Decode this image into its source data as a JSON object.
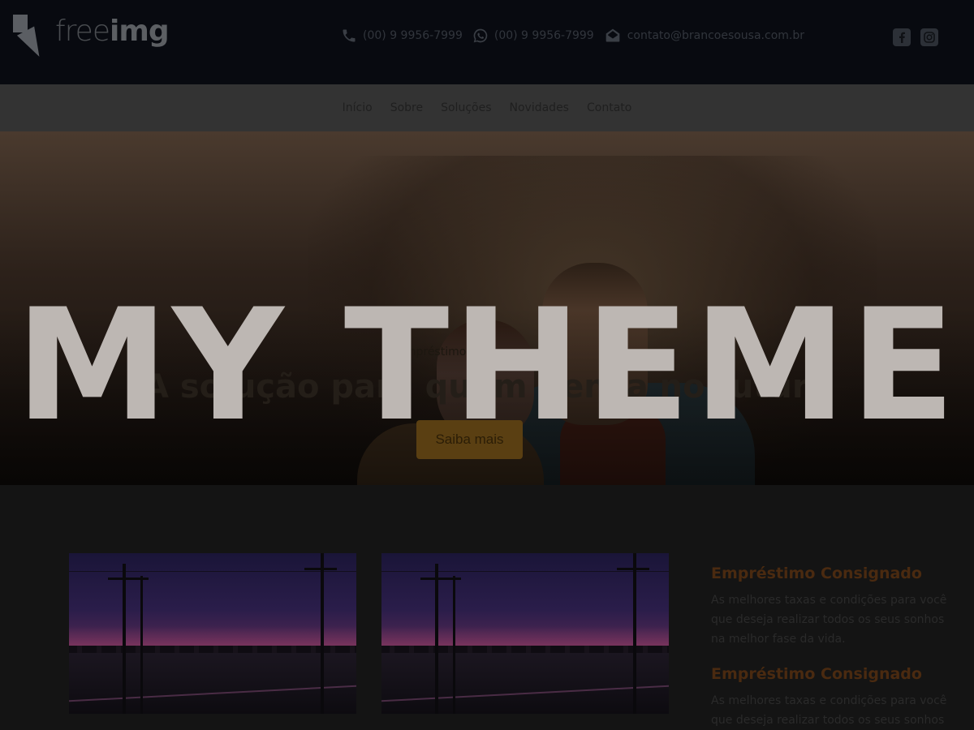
{
  "header": {
    "logo": {
      "light": "free",
      "bold": "img",
      "icon": "map-pin-logo-icon"
    },
    "contacts": [
      {
        "icon": "phone-icon",
        "text": "(00) 9 9956-7999"
      },
      {
        "icon": "whatsapp-icon",
        "text": "(00) 9 9956-7999"
      },
      {
        "icon": "envelope-icon",
        "text": "contato@brancoesousa.com.br"
      }
    ],
    "socials": [
      {
        "icon": "facebook-icon"
      },
      {
        "icon": "instagram-icon"
      }
    ]
  },
  "nav": {
    "items": [
      "Início",
      "Sobre",
      "Soluções",
      "Novidades",
      "Contato"
    ]
  },
  "hero": {
    "kicker": "Empréstimo",
    "title": "A solução para quem pensa no futuro",
    "button_label": "Saiba mais"
  },
  "cards": [
    {
      "image": "railway-sunset-image"
    },
    {
      "image": "railway-sunset-image"
    }
  ],
  "sidebar": {
    "items": [
      {
        "title": "Empréstimo Consignado",
        "text": "As melhores taxas e condições para você que deseja realizar todos os seus sonhos na melhor fase da vida."
      },
      {
        "title": "Empréstimo Consignado",
        "text": "As melhores taxas e condições para você que deseja realizar todos os seus sonhos na melhor fase da vida."
      }
    ]
  },
  "overlay": {
    "text": "MY THEME"
  },
  "colors": {
    "header_bg": "#080a10",
    "nav_bg": "#333333",
    "accent": "#c9881a",
    "overlay_text": "#bdb7b3"
  }
}
